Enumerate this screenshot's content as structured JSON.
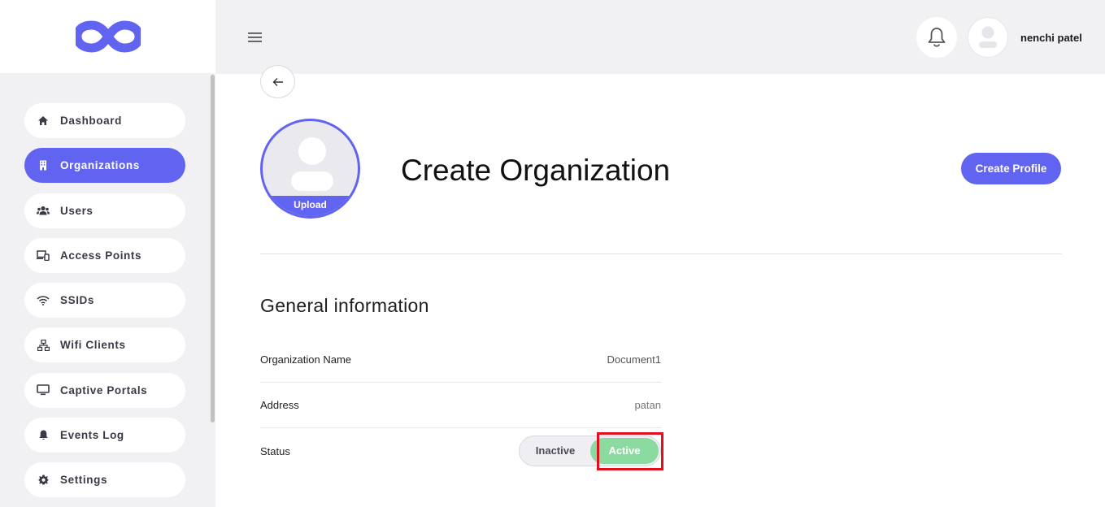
{
  "header": {
    "username": "nenchi patel"
  },
  "sidebar": {
    "items": [
      {
        "label": "Dashboard",
        "icon": "home-icon",
        "active": false
      },
      {
        "label": "Organizations",
        "icon": "building-icon",
        "active": true
      },
      {
        "label": "Users",
        "icon": "users-icon",
        "active": false
      },
      {
        "label": "Access Points",
        "icon": "devices-icon",
        "active": false
      },
      {
        "label": "SSIDs",
        "icon": "wifi-icon",
        "active": false
      },
      {
        "label": "Wifi Clients",
        "icon": "network-icon",
        "active": false
      },
      {
        "label": "Captive Portals",
        "icon": "monitor-icon",
        "active": false
      },
      {
        "label": "Events Log",
        "icon": "bell-icon",
        "active": false
      },
      {
        "label": "Settings",
        "icon": "gear-icon",
        "active": false
      }
    ]
  },
  "profile": {
    "upload_label": "Upload"
  },
  "main": {
    "title": "Create Organization",
    "create_button": "Create Profile",
    "section_title": "General information",
    "fields": {
      "org_name_label": "Organization Name",
      "org_name_value": "Document1",
      "address_label": "Address",
      "address_value": "patan",
      "status_label": "Status"
    },
    "status_toggle": {
      "inactive_label": "Inactive",
      "active_label": "Active",
      "selected": "Active"
    }
  },
  "colors": {
    "accent": "#6164f0",
    "active_green": "#8bdba0",
    "highlight_red": "#e0101f",
    "sidebar_bg": "#f1f1f4"
  }
}
